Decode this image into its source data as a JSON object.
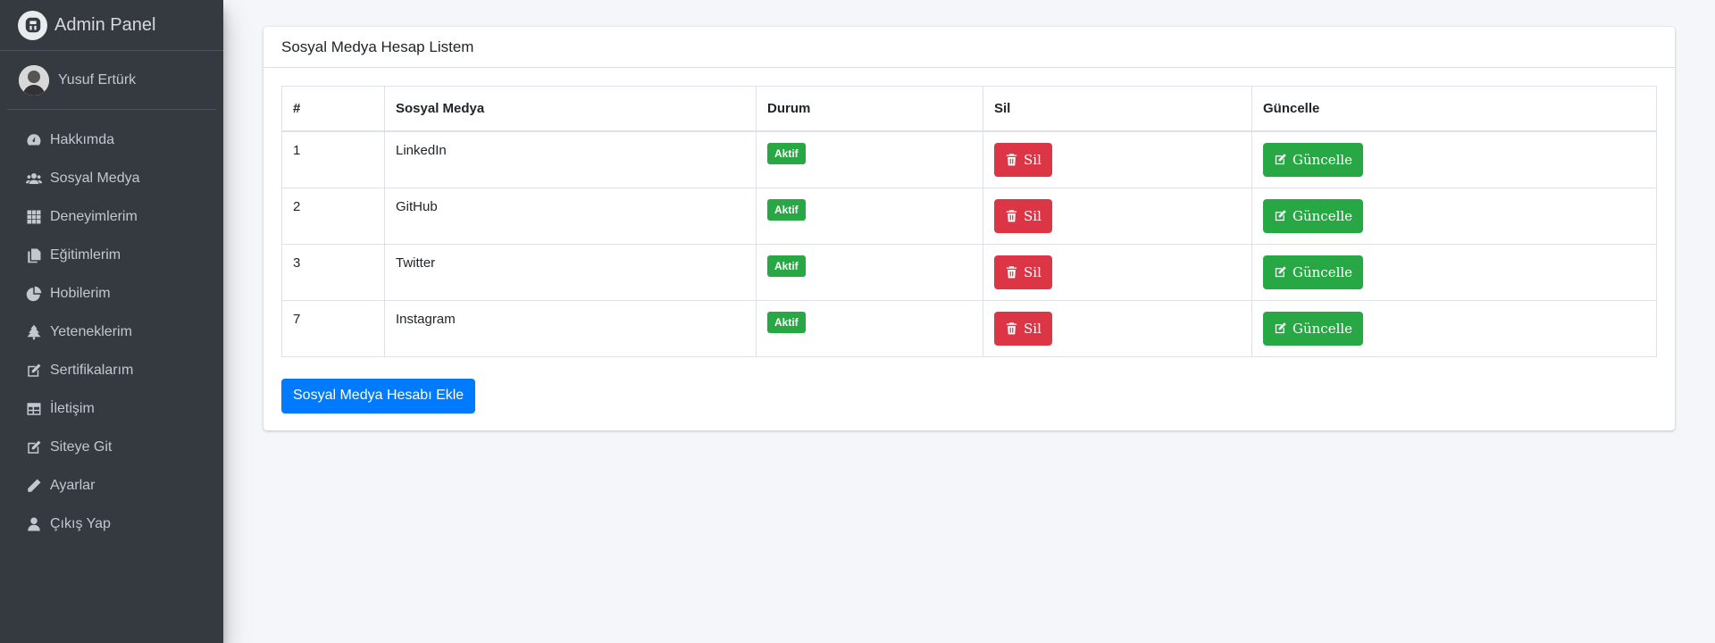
{
  "brand": {
    "title": "Admin Panel"
  },
  "user": {
    "name": "Yusuf Ertürk"
  },
  "nav": [
    {
      "label": "Hakkımda",
      "icon": "tachometer-icon"
    },
    {
      "label": "Sosyal Medya",
      "icon": "users-icon"
    },
    {
      "label": "Deneyimlerim",
      "icon": "grid-icon"
    },
    {
      "label": "Eğitimlerim",
      "icon": "copy-icon"
    },
    {
      "label": "Hobilerim",
      "icon": "pie-chart-icon"
    },
    {
      "label": "Yeteneklerim",
      "icon": "tree-icon"
    },
    {
      "label": "Sertifikalarım",
      "icon": "edit-icon"
    },
    {
      "label": "İletişim",
      "icon": "table-icon"
    },
    {
      "label": "Siteye Git",
      "icon": "edit-icon"
    },
    {
      "label": "Ayarlar",
      "icon": "pencil-icon"
    },
    {
      "label": "Çıkış Yap",
      "icon": "user-icon"
    }
  ],
  "card": {
    "title": "Sosyal Medya Hesap Listem",
    "columns": [
      "#",
      "Sosyal Medya",
      "Durum",
      "Sil",
      "Güncelle"
    ],
    "rows": [
      {
        "id": "1",
        "name": "LinkedIn",
        "status": "Aktif",
        "delete": "Sil",
        "update": "Güncelle"
      },
      {
        "id": "2",
        "name": "GitHub",
        "status": "Aktif",
        "delete": "Sil",
        "update": "Güncelle"
      },
      {
        "id": "3",
        "name": "Twitter",
        "status": "Aktif",
        "delete": "Sil",
        "update": "Güncelle"
      },
      {
        "id": "7",
        "name": "Instagram",
        "status": "Aktif",
        "delete": "Sil",
        "update": "Güncelle"
      }
    ],
    "add_button": "Sosyal Medya Hesabı Ekle"
  },
  "colors": {
    "sidebar": "#343a40",
    "success": "#28a745",
    "danger": "#dc3545",
    "primary": "#007bff"
  }
}
